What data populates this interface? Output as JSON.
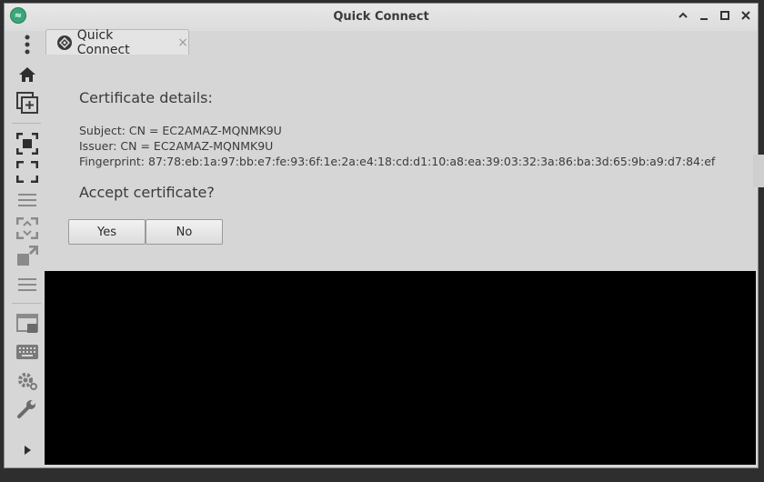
{
  "window": {
    "title": "Quick Connect",
    "app_icon": "remmina-icon",
    "controls": [
      "minimize-up-icon",
      "minimize-icon",
      "maximize-icon",
      "close-icon"
    ]
  },
  "sidebar": {
    "items": [
      {
        "name": "menu-dots-icon"
      },
      {
        "name": "home-icon"
      },
      {
        "name": "new-window-icon"
      },
      {
        "name": "fit-window-icon"
      },
      {
        "name": "fullscreen-icon"
      },
      {
        "name": "list-icon"
      },
      {
        "name": "scale-icon"
      },
      {
        "name": "multi-monitor-icon"
      },
      {
        "name": "list-icon-2"
      },
      {
        "name": "screenshot-icon"
      },
      {
        "name": "keyboard-icon"
      },
      {
        "name": "settings-icon"
      },
      {
        "name": "tools-icon"
      },
      {
        "name": "expand-arrow-icon"
      }
    ]
  },
  "tab": {
    "label": "Quick Connect",
    "close": "×"
  },
  "certificate": {
    "heading": "Certificate details:",
    "subject": "Subject: CN = EC2AMAZ-MQNMK9U",
    "issuer": "Issuer: CN = EC2AMAZ-MQNMK9U",
    "fingerprint": "Fingerprint: 87:78:eb:1a:97:bb:e7:fe:93:6f:1e:2a:e4:18:cd:d1:10:a8:ea:39:03:32:3a:86:ba:3d:65:9b:a9:d7:84:ef",
    "question": "Accept certificate?",
    "yes_label": "Yes",
    "no_label": "No"
  },
  "colors": {
    "background": "#d6d6d6",
    "terminal": "#000000",
    "app_icon": "#3aa67a"
  }
}
